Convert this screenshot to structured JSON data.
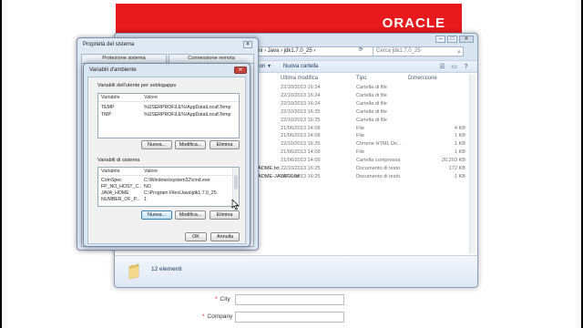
{
  "website": {
    "logo": "ORACLE",
    "form_fields": [
      {
        "label": "City"
      },
      {
        "label": "Company"
      }
    ]
  },
  "explorer": {
    "window_controls": {
      "minimize": "–",
      "maximize": "□",
      "close": "✕"
    },
    "address_text": "mmi › Java › jdk1.7.0_25 ›",
    "search_placeholder": "Cerca jdk1.7.0_25",
    "toolbar": {
      "organize_suffix": "ton",
      "new_folder": "Nuova cartella"
    },
    "columns": {
      "modified": "Ultima modifica",
      "type": "Tipo",
      "size": "Dimensione"
    },
    "files": [
      {
        "name": "",
        "modified": "22/10/2013 16:24",
        "type": "Cartella di file",
        "size": ""
      },
      {
        "name": "",
        "modified": "22/10/2013 16:24",
        "type": "Cartella di file",
        "size": ""
      },
      {
        "name": "",
        "modified": "22/10/2013 16:24",
        "type": "Cartella di file",
        "size": ""
      },
      {
        "name": "",
        "modified": "22/10/2013 16:25",
        "type": "Cartella di file",
        "size": ""
      },
      {
        "name": "",
        "modified": "22/10/2013 16:25",
        "type": "Cartella di file",
        "size": ""
      },
      {
        "name": "",
        "modified": "21/06/2013 14:09",
        "type": "File",
        "size": "4 KB"
      },
      {
        "name": "",
        "modified": "21/06/2013 14:09",
        "type": "File",
        "size": "1 KB"
      },
      {
        "name": "",
        "modified": "22/10/2013 16:25",
        "type": "Chrome HTML Do...",
        "size": "1 KB"
      },
      {
        "name": "",
        "modified": "21/06/2013 14:09",
        "type": "File",
        "size": "1 KB"
      },
      {
        "name": "",
        "modified": "21/06/2013 14:09",
        "type": "Cartella compressa",
        "size": "20.203 KB"
      },
      {
        "name": "ADME.txt",
        "modified": "22/10/2013 16:25",
        "type": "Documento di testo",
        "size": "172 KB"
      },
      {
        "name": "ADME-JAVAFX.txt",
        "modified": "22/10/2013 16:25",
        "type": "Documento di testo",
        "size": "1 KB"
      }
    ],
    "status": "12 elementi"
  },
  "system_properties": {
    "title": "Proprietà del sistema",
    "close": "✕",
    "tabs": [
      "Protezione sistema",
      "Connessione remota"
    ]
  },
  "env_vars": {
    "title": "Variabili d'ambiente",
    "close": "✕",
    "user_group_label": "Variabili dell'utente per seblogapps",
    "system_group_label": "Variabili di sistema",
    "columns": {
      "name": "Variabile",
      "value": "Valore"
    },
    "user_vars": [
      {
        "name": "TEMP",
        "value": "%USERPROFILE%\\AppData\\Local\\Temp"
      },
      {
        "name": "TMP",
        "value": "%USERPROFILE%\\AppData\\Local\\Temp"
      }
    ],
    "system_vars": [
      {
        "name": "ComSpec",
        "value": "C:\\Windows\\system32\\cmd.exe"
      },
      {
        "name": "FP_NO_HOST_C...",
        "value": "NO"
      },
      {
        "name": "JAVA_HOME",
        "value": "C:\\Program Files\\Java\\jdk1.7.0_25"
      },
      {
        "name": "NUMBER_OF_P...",
        "value": "1"
      }
    ],
    "buttons": {
      "new": "Nuova...",
      "edit": "Modifica...",
      "delete": "Elimina",
      "ok": "OK",
      "cancel": "Annulla"
    }
  }
}
